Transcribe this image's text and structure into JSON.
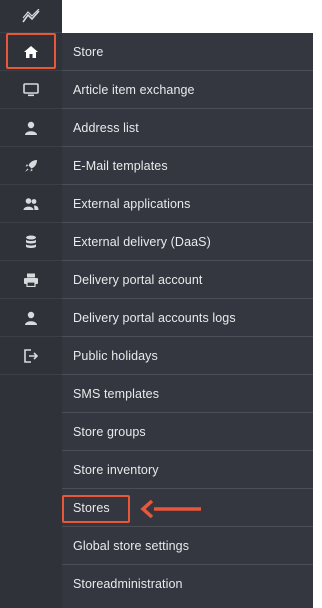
{
  "rail": {
    "items": [
      {
        "icon": "activity-chart-icon"
      },
      {
        "icon": "home-icon"
      },
      {
        "icon": "monitor-icon"
      },
      {
        "icon": "user-icon"
      },
      {
        "icon": "rocket-icon"
      },
      {
        "icon": "users-icon"
      },
      {
        "icon": "database-icon"
      },
      {
        "icon": "printer-icon"
      },
      {
        "icon": "user-profile-icon"
      },
      {
        "icon": "logout-icon"
      }
    ]
  },
  "menu": {
    "items": [
      {
        "label": "Store"
      },
      {
        "label": "Article item exchange"
      },
      {
        "label": "Address list"
      },
      {
        "label": "E-Mail templates"
      },
      {
        "label": "External applications"
      },
      {
        "label": "External delivery (DaaS)"
      },
      {
        "label": "Delivery portal account"
      },
      {
        "label": "Delivery portal accounts logs"
      },
      {
        "label": "Public holidays"
      },
      {
        "label": "SMS templates"
      },
      {
        "label": "Store groups"
      },
      {
        "label": "Store inventory"
      },
      {
        "label": "Stores"
      },
      {
        "label": "Global store settings"
      },
      {
        "label": "Storeadministration"
      }
    ]
  },
  "colors": {
    "rail_bg": "#2f3238",
    "menu_bg": "#34373f",
    "menu_text": "#e9eaec",
    "annotation": "#e8573a",
    "icon": "#d9dadc"
  }
}
